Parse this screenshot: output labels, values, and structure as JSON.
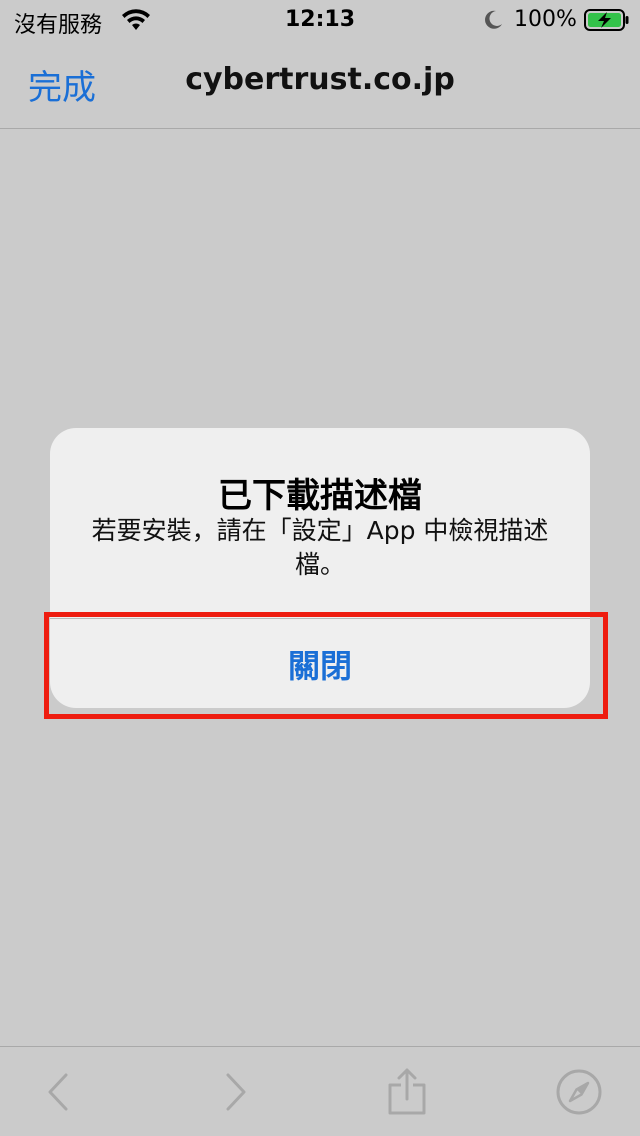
{
  "status_bar": {
    "carrier": "沒有服務",
    "time": "12:13",
    "battery_percent": "100%"
  },
  "nav": {
    "done_label": "完成",
    "title": "cybertrust.co.jp"
  },
  "alert": {
    "title": "已下載描述檔",
    "message": "若要安裝，請在「設定」App 中檢視描述檔。",
    "action_label": "關閉"
  },
  "toolbar": {
    "icons": [
      "back-icon",
      "forward-icon",
      "share-icon",
      "safari-compass-icon"
    ]
  },
  "colors": {
    "accent": "#1a6fd6",
    "highlight": "#ee1c0f",
    "background": "#cbcbcb"
  }
}
